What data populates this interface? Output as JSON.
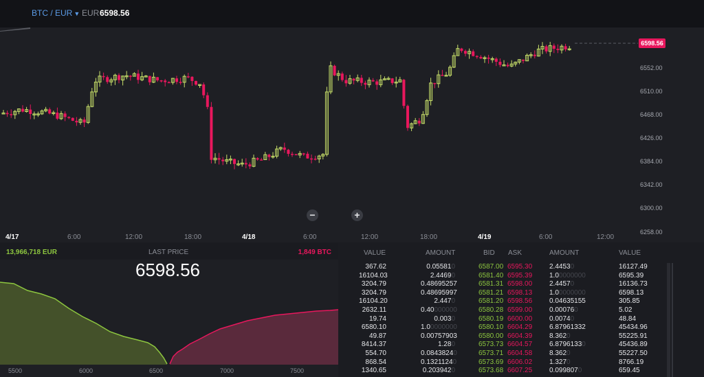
{
  "header": {
    "pair": "BTC / EUR",
    "currency": "EUR",
    "price": "6598.56"
  },
  "chart": {
    "current_price_tag": "6598.56",
    "y_axis": [
      "6552.00",
      "6510.00",
      "6468.00",
      "6426.00",
      "6384.00",
      "6342.00",
      "6300.00",
      "6258.00"
    ],
    "x_axis": [
      {
        "label": "4/17",
        "day": true
      },
      {
        "label": "6:00",
        "day": false
      },
      {
        "label": "12:00",
        "day": false
      },
      {
        "label": "18:00",
        "day": false
      },
      {
        "label": "4/18",
        "day": true
      },
      {
        "label": "6:00",
        "day": false
      },
      {
        "label": "12:00",
        "day": false
      },
      {
        "label": "18:00",
        "day": false
      },
      {
        "label": "4/19",
        "day": true
      },
      {
        "label": "6:00",
        "day": false
      },
      {
        "label": "12:00",
        "day": false
      }
    ],
    "zoom_out": "−",
    "zoom_in": "+",
    "colors": {
      "up": "#c8e06a",
      "down": "#e8175d"
    }
  },
  "depth": {
    "bid_volume": "13,966,718 EUR",
    "last_price_label": "LAST PRICE",
    "last_price": "6598.56",
    "ask_volume": "1,849 BTC",
    "x_axis": [
      "5500",
      "6000",
      "6500",
      "7000",
      "7500"
    ],
    "colors": {
      "bid": "#8dc63f",
      "ask": "#e8175d"
    }
  },
  "orderbook": {
    "headers": {
      "value": "VALUE",
      "amount": "AMOUNT",
      "bid": "BID",
      "ask": "ASK",
      "amount2": "AMOUNT",
      "value2": "VALUE"
    },
    "rows": [
      {
        "value": "367.62",
        "amount": "0.05581",
        "amount_pad": "0",
        "bid": "6587.00",
        "ask": "6595.30",
        "amount2": "2.4453",
        "amount2_pad": "0",
        "value2": "16127.49"
      },
      {
        "value": "16104.03",
        "amount": "2.4469",
        "amount_pad": "0",
        "bid": "6581.40",
        "ask": "6595.39",
        "amount2": "1.0",
        "amount2_pad": "0000000",
        "value2": "6595.39"
      },
      {
        "value": "3204.79",
        "amount": "0.48695257",
        "amount_pad": "",
        "bid": "6581.31",
        "ask": "6598.00",
        "amount2": "2.4457",
        "amount2_pad": "0",
        "value2": "16136.73"
      },
      {
        "value": "3204.79",
        "amount": "0.48695997",
        "amount_pad": "",
        "bid": "6581.21",
        "ask": "6598.13",
        "amount2": "1.0",
        "amount2_pad": "0000000",
        "value2": "6598.13"
      },
      {
        "value": "16104.20",
        "amount": "2.447",
        "amount_pad": "0",
        "bid": "6581.20",
        "ask": "6598.56",
        "amount2": "0.04635155",
        "amount2_pad": "",
        "value2": "305.85"
      },
      {
        "value": "2632.11",
        "amount": "0.40",
        "amount_pad": "000000",
        "bid": "6580.28",
        "ask": "6599.00",
        "amount2": "0.00076",
        "amount2_pad": "0",
        "value2": "5.02"
      },
      {
        "value": "19.74",
        "amount": "0.003",
        "amount_pad": "0",
        "bid": "6580.19",
        "ask": "6600.00",
        "amount2": "0.0074",
        "amount2_pad": "0",
        "value2": "48.84"
      },
      {
        "value": "6580.10",
        "amount": "1.0",
        "amount_pad": "0000000",
        "bid": "6580.10",
        "ask": "6604.29",
        "amount2": "6.87961332",
        "amount2_pad": "",
        "value2": "45434.96"
      },
      {
        "value": "49.87",
        "amount": "0.00757903",
        "amount_pad": "",
        "bid": "6580.00",
        "ask": "6604.39",
        "amount2": "8.362",
        "amount2_pad": "0",
        "value2": "55225.91"
      },
      {
        "value": "8414.37",
        "amount": "1.28",
        "amount_pad": "0",
        "bid": "6573.73",
        "ask": "6604.57",
        "amount2": "6.8796133",
        "amount2_pad": "0",
        "value2": "45436.89"
      },
      {
        "value": "554.70",
        "amount": "0.0843824",
        "amount_pad": "0",
        "bid": "6573.71",
        "ask": "6604.58",
        "amount2": "8.362",
        "amount2_pad": "0",
        "value2": "55227.50"
      },
      {
        "value": "868.54",
        "amount": "0.1321124",
        "amount_pad": "0",
        "bid": "6573.69",
        "ask": "6606.02",
        "amount2": "1.327",
        "amount2_pad": "0",
        "value2": "8766.19"
      },
      {
        "value": "1340.65",
        "amount": "0.203942",
        "amount_pad": "0",
        "bid": "6573.68",
        "ask": "6607.25",
        "amount2": "0.099807",
        "amount2_pad": "0",
        "value2": "659.45"
      }
    ]
  }
}
